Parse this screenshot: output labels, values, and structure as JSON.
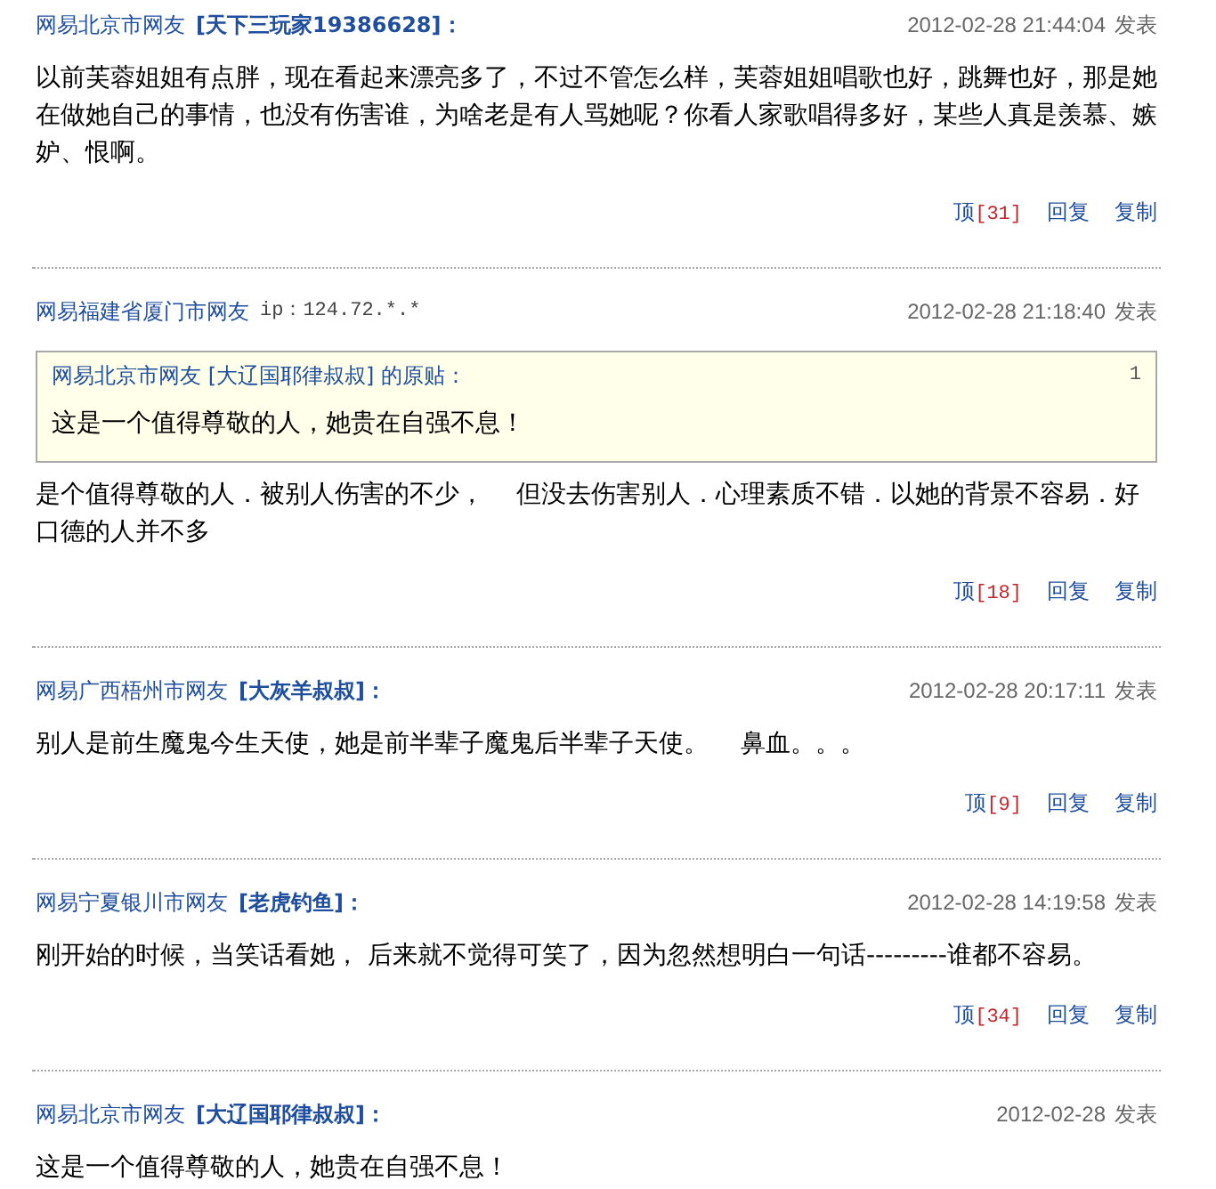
{
  "posts": [
    {
      "location": "网易北京市网友",
      "nickname": "[天下三玩家19386628]：",
      "time": "2012-02-28 21:44:04",
      "posted_label": "发表",
      "body": "以前芙蓉姐姐有点胖，现在看起来漂亮多了，不过不管怎么样，芙蓉姐姐唱歌也好，跳舞也好，那是她在做她自己的事情，也没有伤害谁，为啥老是有人骂她呢？你看人家歌唱得多好，某些人真是羡慕、嫉妒、恨啊。",
      "actions": {
        "up_label": "顶",
        "up_count": "[31]",
        "reply": "回复",
        "copy": "复制"
      }
    },
    {
      "location": "网易福建省厦门市网友",
      "ip": "ip：124.72.*.*",
      "time": "2012-02-28 21:18:40",
      "posted_label": "发表",
      "quote": {
        "source": "网易北京市网友 [大辽国耶律叔叔] 的原贴：",
        "floor": "1",
        "text": "这是一个值得尊敬的人，她贵在自强不息！"
      },
      "body": "是个值得尊敬的人．被别人伤害的不少，    但没去伤害别人．心理素质不错．以她的背景不容易．好口德的人并不多",
      "actions": {
        "up_label": "顶",
        "up_count": "[18]",
        "reply": "回复",
        "copy": "复制"
      }
    },
    {
      "location": "网易广西梧州市网友",
      "nickname": "[大灰羊叔叔]：",
      "time": "2012-02-28 20:17:11",
      "posted_label": "发表",
      "body": "别人是前生魔鬼今生天使，她是前半辈子魔鬼后半辈子天使。    鼻血。。。",
      "actions": {
        "up_label": "顶",
        "up_count": "[9]",
        "reply": "回复",
        "copy": "复制"
      }
    },
    {
      "location": "网易宁夏银川市网友",
      "nickname": "[老虎钓鱼]：",
      "time": "2012-02-28 14:19:58",
      "posted_label": "发表",
      "body": "刚开始的时候，当笑话看她， 后来就不觉得可笑了，因为忽然想明白一句话---------谁都不容易。",
      "actions": {
        "up_label": "顶",
        "up_count": "[34]",
        "reply": "回复",
        "copy": "复制"
      }
    },
    {
      "location": "网易北京市网友",
      "nickname": "[大辽国耶律叔叔]：",
      "time": "2012-02-28",
      "posted_label": "发表",
      "body": "这是一个值得尊敬的人，她贵在自强不息！"
    }
  ]
}
